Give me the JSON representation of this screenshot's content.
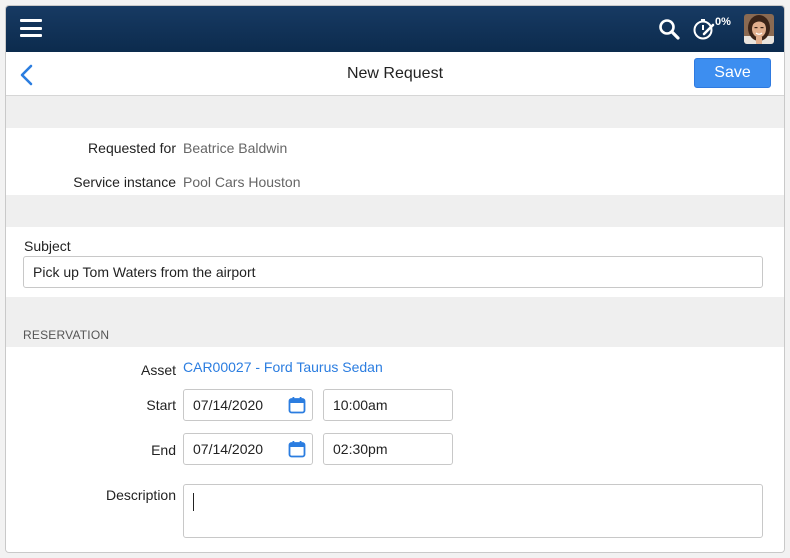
{
  "topbar": {
    "menu_icon": "hamburger-menu-icon",
    "search_icon": "search-icon",
    "timer_icon": "stopwatch-pen-icon",
    "timer_percent": "0%",
    "avatar_icon": "user-avatar"
  },
  "header": {
    "back_icon": "chevron-left-icon",
    "title": "New Request",
    "save_label": "Save"
  },
  "request": {
    "requested_for_label": "Requested for",
    "requested_for_value": "Beatrice Baldwin",
    "service_instance_label": "Service instance",
    "service_instance_value": "Pool Cars Houston"
  },
  "subject": {
    "label": "Subject",
    "value": "Pick up Tom Waters from the airport"
  },
  "reservation": {
    "heading": "RESERVATION",
    "asset_label": "Asset",
    "asset_value": "CAR00027 - Ford Taurus Sedan",
    "start_label": "Start",
    "start_date": "07/14/2020",
    "start_time": "10:00am",
    "end_label": "End",
    "end_date": "07/14/2020",
    "end_time": "02:30pm",
    "description_label": "Description",
    "description_value": "",
    "calendar_icon": "calendar-icon"
  },
  "colors": {
    "topbar": "#0c2b4d",
    "accent": "#3d8ef0",
    "link": "#2b7de0"
  }
}
